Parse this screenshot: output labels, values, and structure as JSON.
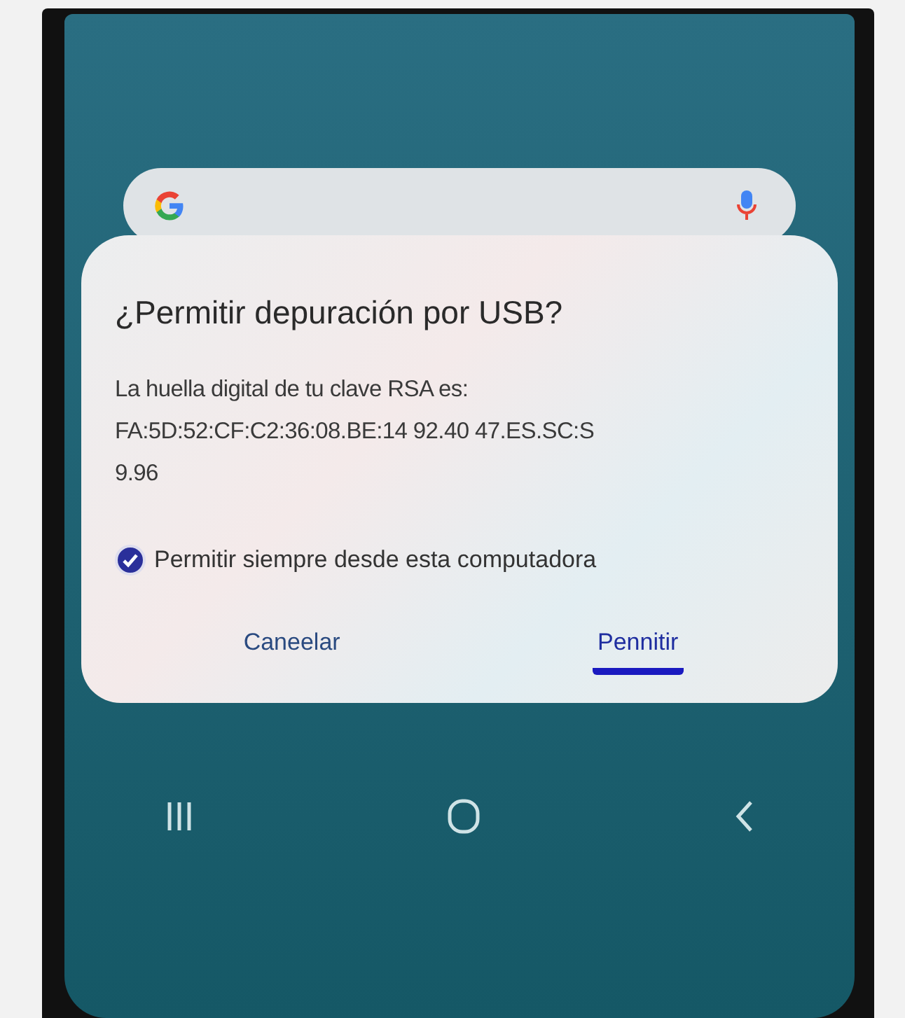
{
  "dialog": {
    "title": "¿Permitir depuración por USB?",
    "message": "La huella digital de tu clave RSA es:",
    "fingerprint": [
      "FA:5D:52:CF:C2:36:08.BE:14 92.40 47.ES.SC:S",
      "9.96"
    ],
    "checkbox": {
      "label": "Permitir siempre desde esta computadora",
      "checked": true
    },
    "buttons": [
      {
        "label": "Caneelar",
        "selected": false
      },
      {
        "label": "Pennitir",
        "selected": true
      }
    ]
  },
  "nav_bar": [
    {
      "kind": "recents"
    },
    {
      "kind": "home"
    },
    {
      "kind": "back"
    }
  ]
}
